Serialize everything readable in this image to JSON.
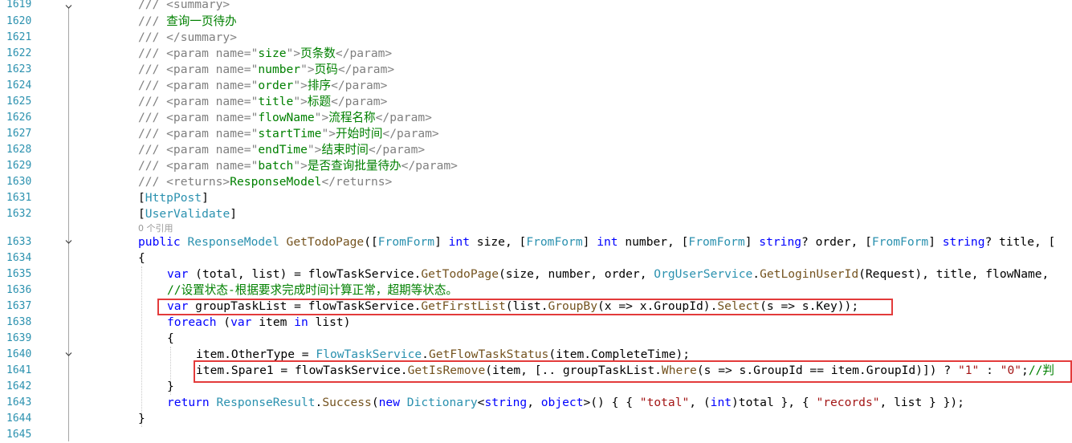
{
  "editor": {
    "language": "C#",
    "codelens_refs": "0 个引用",
    "lines": [
      {
        "n": "1619",
        "parts": [
          [
            "xd",
            "/// <summary>"
          ]
        ]
      },
      {
        "n": "1620",
        "parts": [
          [
            "xd",
            "/// "
          ],
          [
            "cm",
            "查询一页待办"
          ]
        ]
      },
      {
        "n": "1621",
        "parts": [
          [
            "xd",
            "/// </summary>"
          ]
        ]
      },
      {
        "n": "1622",
        "parts": [
          [
            "xd",
            "/// <param name=\""
          ],
          [
            "cm",
            "size"
          ],
          [
            "xd",
            "\">"
          ],
          [
            "cm",
            "页条数"
          ],
          [
            "xd",
            "</param>"
          ]
        ]
      },
      {
        "n": "1623",
        "parts": [
          [
            "xd",
            "/// <param name=\""
          ],
          [
            "cm",
            "number"
          ],
          [
            "xd",
            "\">"
          ],
          [
            "cm",
            "页码"
          ],
          [
            "xd",
            "</param>"
          ]
        ]
      },
      {
        "n": "1624",
        "parts": [
          [
            "xd",
            "/// <param name=\""
          ],
          [
            "cm",
            "order"
          ],
          [
            "xd",
            "\">"
          ],
          [
            "cm",
            "排序"
          ],
          [
            "xd",
            "</param>"
          ]
        ]
      },
      {
        "n": "1625",
        "parts": [
          [
            "xd",
            "/// <param name=\""
          ],
          [
            "cm",
            "title"
          ],
          [
            "xd",
            "\">"
          ],
          [
            "cm",
            "标题"
          ],
          [
            "xd",
            "</param>"
          ]
        ]
      },
      {
        "n": "1626",
        "parts": [
          [
            "xd",
            "/// <param name=\""
          ],
          [
            "cm",
            "flowName"
          ],
          [
            "xd",
            "\">"
          ],
          [
            "cm",
            "流程名称"
          ],
          [
            "xd",
            "</param>"
          ]
        ]
      },
      {
        "n": "1627",
        "parts": [
          [
            "xd",
            "/// <param name=\""
          ],
          [
            "cm",
            "startTime"
          ],
          [
            "xd",
            "\">"
          ],
          [
            "cm",
            "开始时间"
          ],
          [
            "xd",
            "</param>"
          ]
        ]
      },
      {
        "n": "1628",
        "parts": [
          [
            "xd",
            "/// <param name=\""
          ],
          [
            "cm",
            "endTime"
          ],
          [
            "xd",
            "\">"
          ],
          [
            "cm",
            "结束时间"
          ],
          [
            "xd",
            "</param>"
          ]
        ]
      },
      {
        "n": "1629",
        "parts": [
          [
            "xd",
            "/// <param name=\""
          ],
          [
            "cm",
            "batch"
          ],
          [
            "xd",
            "\">"
          ],
          [
            "cm",
            "是否查询批量待办"
          ],
          [
            "xd",
            "</param>"
          ]
        ]
      },
      {
        "n": "1630",
        "parts": [
          [
            "xd",
            "/// <returns>"
          ],
          [
            "cm",
            "ResponseModel"
          ],
          [
            "xd",
            "</returns>"
          ]
        ]
      },
      {
        "n": "1631",
        "parts": [
          [
            "",
            "["
          ],
          [
            "ty",
            "HttpPost"
          ],
          [
            "",
            "]"
          ]
        ]
      },
      {
        "n": "1632",
        "parts": [
          [
            "",
            "["
          ],
          [
            "ty",
            "UserValidate"
          ],
          [
            "",
            "]"
          ]
        ]
      },
      {
        "n": "1633",
        "parts": [
          [
            "kw",
            "public "
          ],
          [
            "ty",
            "ResponseModel "
          ],
          [
            "mt",
            "GetTodoPage"
          ],
          [
            "",
            "(["
          ],
          [
            "ty",
            "FromForm"
          ],
          [
            "",
            "] "
          ],
          [
            "kw",
            "int "
          ],
          [
            "",
            "size, ["
          ],
          [
            "ty",
            "FromForm"
          ],
          [
            "",
            "] "
          ],
          [
            "kw",
            "int "
          ],
          [
            "",
            "number, ["
          ],
          [
            "ty",
            "FromForm"
          ],
          [
            "",
            "] "
          ],
          [
            "kw",
            "string"
          ],
          [
            "",
            "? order, ["
          ],
          [
            "ty",
            "FromForm"
          ],
          [
            "",
            "] "
          ],
          [
            "kw",
            "string"
          ],
          [
            "",
            "? title, ["
          ]
        ]
      },
      {
        "n": "1634",
        "parts": [
          [
            "",
            "{"
          ]
        ]
      },
      {
        "n": "1635",
        "parts": [
          [
            "kw",
            "var "
          ],
          [
            "",
            "(total, list) = flowTaskService."
          ],
          [
            "mt",
            "GetTodoPage"
          ],
          [
            "",
            "(size, number, order, "
          ],
          [
            "ty",
            "OrgUserService"
          ],
          [
            "",
            "."
          ],
          [
            "mt",
            "GetLoginUserId"
          ],
          [
            "",
            "(Request), title, flowName, "
          ]
        ]
      },
      {
        "n": "1636",
        "parts": [
          [
            "cm",
            "//设置状态-根据要求完成时间计算正常，超期等状态。"
          ]
        ]
      },
      {
        "n": "1637",
        "parts": [
          [
            "kw",
            "var "
          ],
          [
            "",
            "groupTaskList = flowTaskService."
          ],
          [
            "mt",
            "GetFirstList"
          ],
          [
            "",
            "(list."
          ],
          [
            "mt",
            "GroupBy"
          ],
          [
            "",
            "(x => x.GroupId)."
          ],
          [
            "mt",
            "Select"
          ],
          [
            "",
            "(s => s.Key));"
          ]
        ]
      },
      {
        "n": "1638",
        "parts": [
          [
            "kw",
            "foreach "
          ],
          [
            "",
            "("
          ],
          [
            "kw",
            "var "
          ],
          [
            "",
            "item "
          ],
          [
            "kw",
            "in "
          ],
          [
            "",
            "list)"
          ]
        ]
      },
      {
        "n": "1639",
        "parts": [
          [
            "",
            "{"
          ]
        ]
      },
      {
        "n": "1640",
        "parts": [
          [
            "",
            "item.OtherType = "
          ],
          [
            "ty",
            "FlowTaskService"
          ],
          [
            "",
            "."
          ],
          [
            "mt",
            "GetFlowTaskStatus"
          ],
          [
            "",
            "(item.CompleteTime);"
          ]
        ]
      },
      {
        "n": "1641",
        "parts": [
          [
            "",
            "item.Spare1 = flowTaskService."
          ],
          [
            "mt",
            "GetIsRemove"
          ],
          [
            "",
            "(item, [.. groupTaskList."
          ],
          [
            "mt",
            "Where"
          ],
          [
            "",
            "(s => s.GroupId == item.GroupId)]) ? "
          ],
          [
            "st",
            "\"1\""
          ],
          [
            "",
            " : "
          ],
          [
            "st",
            "\"0\""
          ],
          [
            "",
            ";"
          ],
          [
            "cm",
            "//判"
          ]
        ]
      },
      {
        "n": "1642",
        "parts": [
          [
            "",
            "}"
          ]
        ]
      },
      {
        "n": "1643",
        "parts": [
          [
            "kw",
            "return "
          ],
          [
            "ty",
            "ResponseResult"
          ],
          [
            "",
            "."
          ],
          [
            "mt",
            "Success"
          ],
          [
            "",
            "("
          ],
          [
            "kw",
            "new "
          ],
          [
            "ty",
            "Dictionary"
          ],
          [
            "",
            "<"
          ],
          [
            "kw",
            "string"
          ],
          [
            "",
            ", "
          ],
          [
            "kw",
            "object"
          ],
          [
            "",
            ">() { { "
          ],
          [
            "st",
            "\"total\""
          ],
          [
            "",
            ", ("
          ],
          [
            "kw",
            "int"
          ],
          [
            "",
            ")total }, { "
          ],
          [
            "st",
            "\"records\""
          ],
          [
            "",
            ", list } });"
          ]
        ]
      },
      {
        "n": "1644",
        "parts": [
          [
            "",
            "}"
          ]
        ]
      },
      {
        "n": "1645",
        "parts": []
      }
    ]
  }
}
